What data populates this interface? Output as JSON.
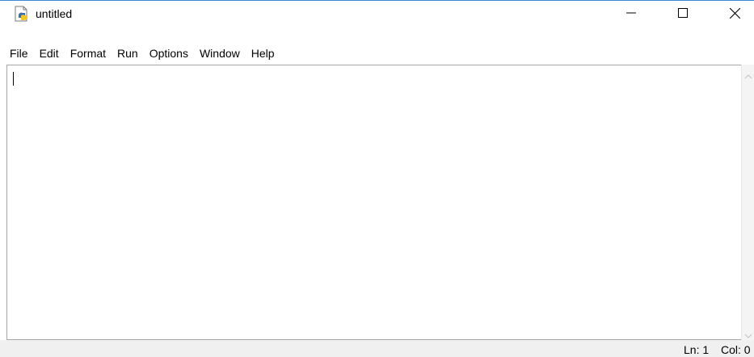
{
  "window": {
    "title": "untitled",
    "icon": "python-idle-icon",
    "controls": {
      "minimize": "minimize-icon",
      "maximize": "maximize-icon",
      "close": "close-icon"
    }
  },
  "menubar": {
    "items": [
      {
        "label": "File"
      },
      {
        "label": "Edit"
      },
      {
        "label": "Format"
      },
      {
        "label": "Run"
      },
      {
        "label": "Options"
      },
      {
        "label": "Window"
      },
      {
        "label": "Help"
      }
    ]
  },
  "editor": {
    "content": ""
  },
  "statusbar": {
    "line": "Ln: 1",
    "column": "Col: 0"
  },
  "colors": {
    "window_border": "#3c87d6",
    "editor_border": "#a6a6a6",
    "statusbar_bg": "#f0f0f0",
    "scrollbar_bg": "#f4f4f4"
  }
}
